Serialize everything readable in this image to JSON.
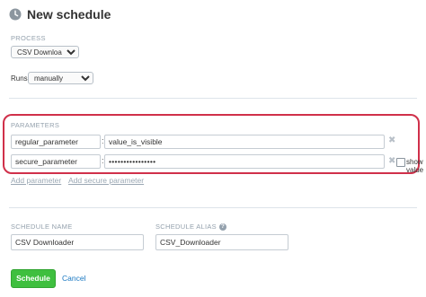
{
  "header": {
    "title": "New schedule",
    "icon": "clock-icon"
  },
  "process": {
    "label": "PROCESS",
    "selected": "CSV Downloader"
  },
  "runs": {
    "label": "Runs",
    "selected": "manually"
  },
  "parameters": {
    "label": "PARAMETERS",
    "rows": [
      {
        "name": "regular_parameter",
        "value": "value_is_visible",
        "secure": false
      },
      {
        "name": "secure_parameter",
        "value": "••••••••••••••••",
        "secure": true,
        "show_value_label": "show value"
      }
    ],
    "add_parameter": "Add parameter",
    "add_secure_parameter": "Add secure parameter",
    "highlight_color": "#d0304a"
  },
  "schedule_name": {
    "label": "SCHEDULE NAME",
    "value": "CSV Downloader"
  },
  "schedule_alias": {
    "label": "SCHEDULE ALIAS",
    "value": "CSV_Downloader"
  },
  "actions": {
    "submit": "Schedule",
    "cancel": "Cancel",
    "submit_color": "#3fbf3f"
  }
}
